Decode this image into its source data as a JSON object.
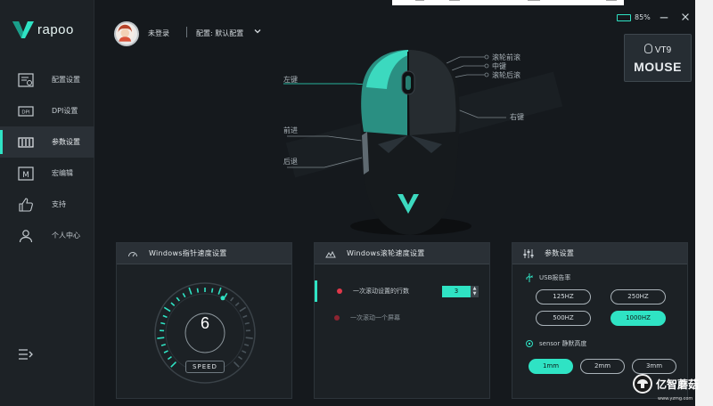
{
  "brand": {
    "name": "rapoo"
  },
  "sidebar": {
    "items": [
      {
        "label": "配置设置",
        "icon": "config-icon",
        "active": false
      },
      {
        "label": "DPI设置",
        "icon": "dpi-icon",
        "active": false
      },
      {
        "label": "参数设置",
        "icon": "params-icon",
        "active": true
      },
      {
        "label": "宏编辑",
        "icon": "macro-icon",
        "active": false
      },
      {
        "label": "支持",
        "icon": "thumbs-up-icon",
        "active": false
      },
      {
        "label": "个人中心",
        "icon": "user-icon",
        "active": false
      }
    ],
    "collapse_icon": "collapse-menu-icon"
  },
  "header": {
    "login_text": "未登录",
    "config_text": "配置: 默认配置",
    "battery_level": 0.85,
    "battery_text": "85%",
    "device_model": "VT9",
    "device_name": "MOUSE"
  },
  "mouse_callouts": {
    "left_key": "左键",
    "forward": "前进",
    "back": "后退",
    "right_key": "右键",
    "top1": "滚轮前滚",
    "top2": "中键",
    "top3": "滚轮后滚"
  },
  "pointer_panel": {
    "title": "Windows指针速度设置",
    "value": "6",
    "speed_label": "SPEED",
    "level_fraction": 0.6
  },
  "scroll_panel": {
    "title": "Windows滚轮速度设置",
    "row1_label": "一次滚动设置的行数",
    "row1_value": "3",
    "row2_label": "一次滚动一个屏幕"
  },
  "params_panel": {
    "title": "参数设置",
    "usb_label": "USB报告率",
    "usb_options": [
      "125HZ",
      "250HZ",
      "500HZ",
      "1000HZ"
    ],
    "usb_selected": "1000HZ",
    "lod_label": "sensor 静默高度",
    "lod_options": [
      "1mm",
      "2mm",
      "3mm"
    ],
    "lod_selected": "1mm"
  },
  "watermark": {
    "text": "亿智蘑菇",
    "url": "www.yzmg.com"
  },
  "colors": {
    "accent": "#2fe3c4",
    "background": "#15191d",
    "panel": "#1c2125",
    "alert": "#e0384a"
  }
}
